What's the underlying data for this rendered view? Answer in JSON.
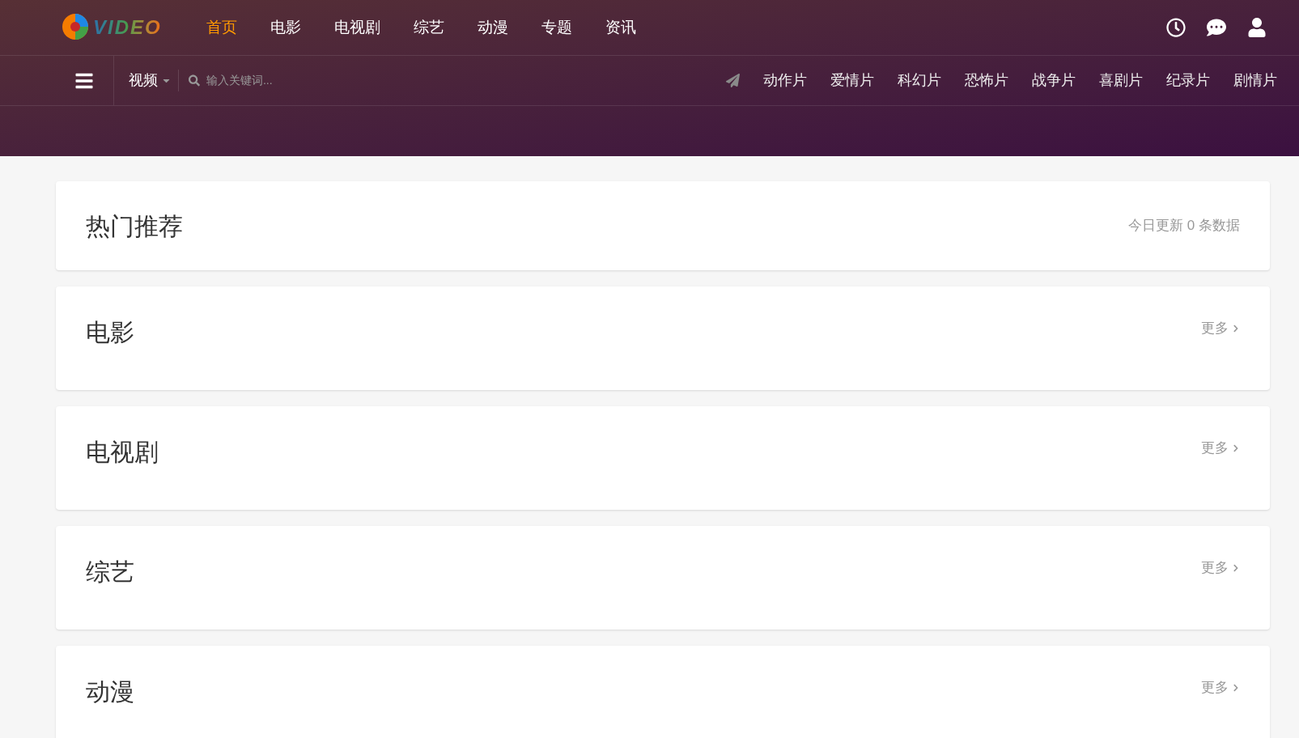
{
  "logo": {
    "text": "VIDEO"
  },
  "nav": [
    {
      "label": "首页",
      "selected": true
    },
    {
      "label": "电影",
      "selected": false
    },
    {
      "label": "电视剧",
      "selected": false
    },
    {
      "label": "综艺",
      "selected": false
    },
    {
      "label": "动漫",
      "selected": false
    },
    {
      "label": "专题",
      "selected": false
    },
    {
      "label": "资讯",
      "selected": false
    }
  ],
  "search": {
    "category": "视频",
    "placeholder": "输入关键词..."
  },
  "genres": [
    "动作片",
    "爱情片",
    "科幻片",
    "恐怖片",
    "战争片",
    "喜剧片",
    "纪录片",
    "剧情片"
  ],
  "sections": [
    {
      "kind": "info",
      "title": "热门推荐",
      "note": "今日更新 0 条数据"
    },
    {
      "kind": "more",
      "title": "电影",
      "note": "更多"
    },
    {
      "kind": "more",
      "title": "电视剧",
      "note": "更多"
    },
    {
      "kind": "more",
      "title": "综艺",
      "note": "更多"
    },
    {
      "kind": "more",
      "title": "动漫",
      "note": "更多"
    }
  ]
}
